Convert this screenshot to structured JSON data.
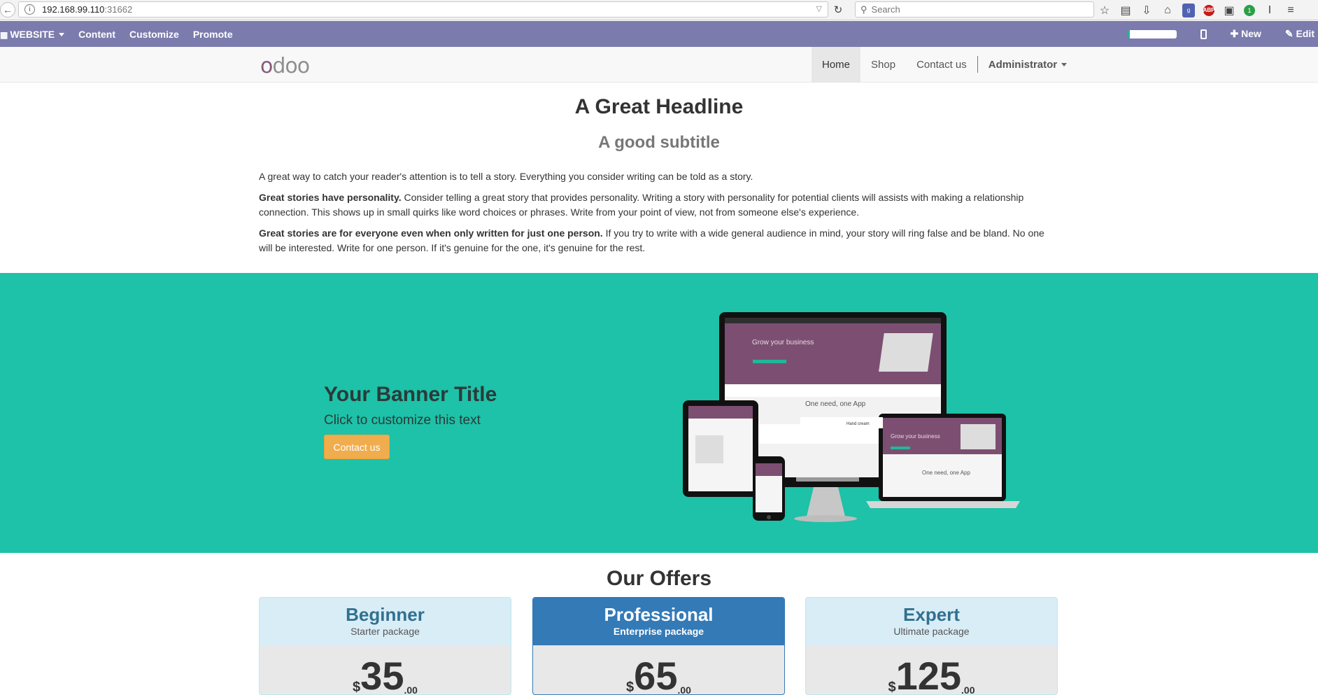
{
  "browser": {
    "url_host": "192.168.99.110",
    "url_port": ":31662",
    "search_placeholder": "Search"
  },
  "editor_bar": {
    "website_label": "WEBSITE",
    "menu": [
      "Content",
      "Customize",
      "Promote"
    ],
    "new_label": "New",
    "edit_label": "Edit"
  },
  "site_nav": {
    "items": [
      "Home",
      "Shop",
      "Contact us"
    ],
    "active": "Home",
    "user": "Administrator"
  },
  "content": {
    "headline": "A Great Headline",
    "subtitle": "A good subtitle",
    "p1": "A great way to catch your reader's attention is to tell a story. Everything you consider writing can be told as a story.",
    "p2_bold": "Great stories have personality.",
    "p2_rest": " Consider telling a great story that provides personality. Writing a story with personality for potential clients will assists with making a relationship connection. This shows up in small quirks like word choices or phrases. Write from your point of view, not from someone else's experience.",
    "p3_bold": "Great stories are for everyone even when only written for just one person.",
    "p3_rest": " If you try to write with a wide general audience in mind, your story will ring false and be bland. No one will be interested. Write for one person. If it's genuine for the one, it's genuine for the rest."
  },
  "banner": {
    "title": "Your Banner Title",
    "text": "Click to customize this text",
    "button": "Contact us",
    "device_screen_title": "Grow your business",
    "device_screen_tagline": "One need, one App",
    "device_screen_item": "Hand cream",
    "bg_color": "#1dc2a8"
  },
  "offers": {
    "title": "Our Offers",
    "cards": [
      {
        "name": "Beginner",
        "sub": "Starter package",
        "currency": "$",
        "amount": "35",
        "cents": ".00"
      },
      {
        "name": "Professional",
        "sub": "Enterprise package",
        "currency": "$",
        "amount": "65",
        "cents": ".00"
      },
      {
        "name": "Expert",
        "sub": "Ultimate package",
        "currency": "$",
        "amount": "125",
        "cents": ".00"
      }
    ]
  },
  "colors": {
    "editor_bar": "#7c7bad",
    "odoo_purple": "#875a7b",
    "button_orange": "#f0ad4e",
    "primary_blue": "#337ab7"
  }
}
